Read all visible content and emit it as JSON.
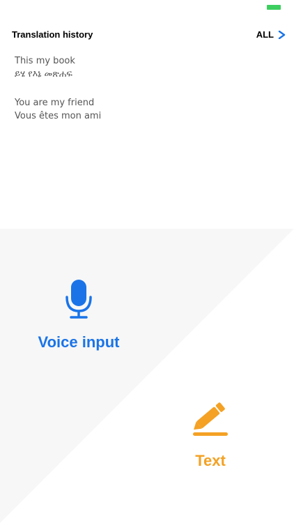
{
  "status_bar": {
    "battery_color": "#3ccf5f"
  },
  "history": {
    "title": "Translation history",
    "all_label": "ALL",
    "items": [
      {
        "source": "This my book",
        "translation": "ይሄ የእኔ መጽሐፍ"
      },
      {
        "source": "You are my friend",
        "translation": "Vous êtes mon ami"
      }
    ]
  },
  "actions": {
    "voice": {
      "label": "Voice input",
      "icon": "microphone-icon",
      "color": "#1a74e8"
    },
    "text": {
      "label": "Text",
      "icon": "pencil-icon",
      "color": "#f4a124"
    }
  },
  "colors": {
    "panel_gray": "#f7f7f7",
    "accent_blue": "#1a74e8",
    "accent_orange": "#f4a124"
  }
}
